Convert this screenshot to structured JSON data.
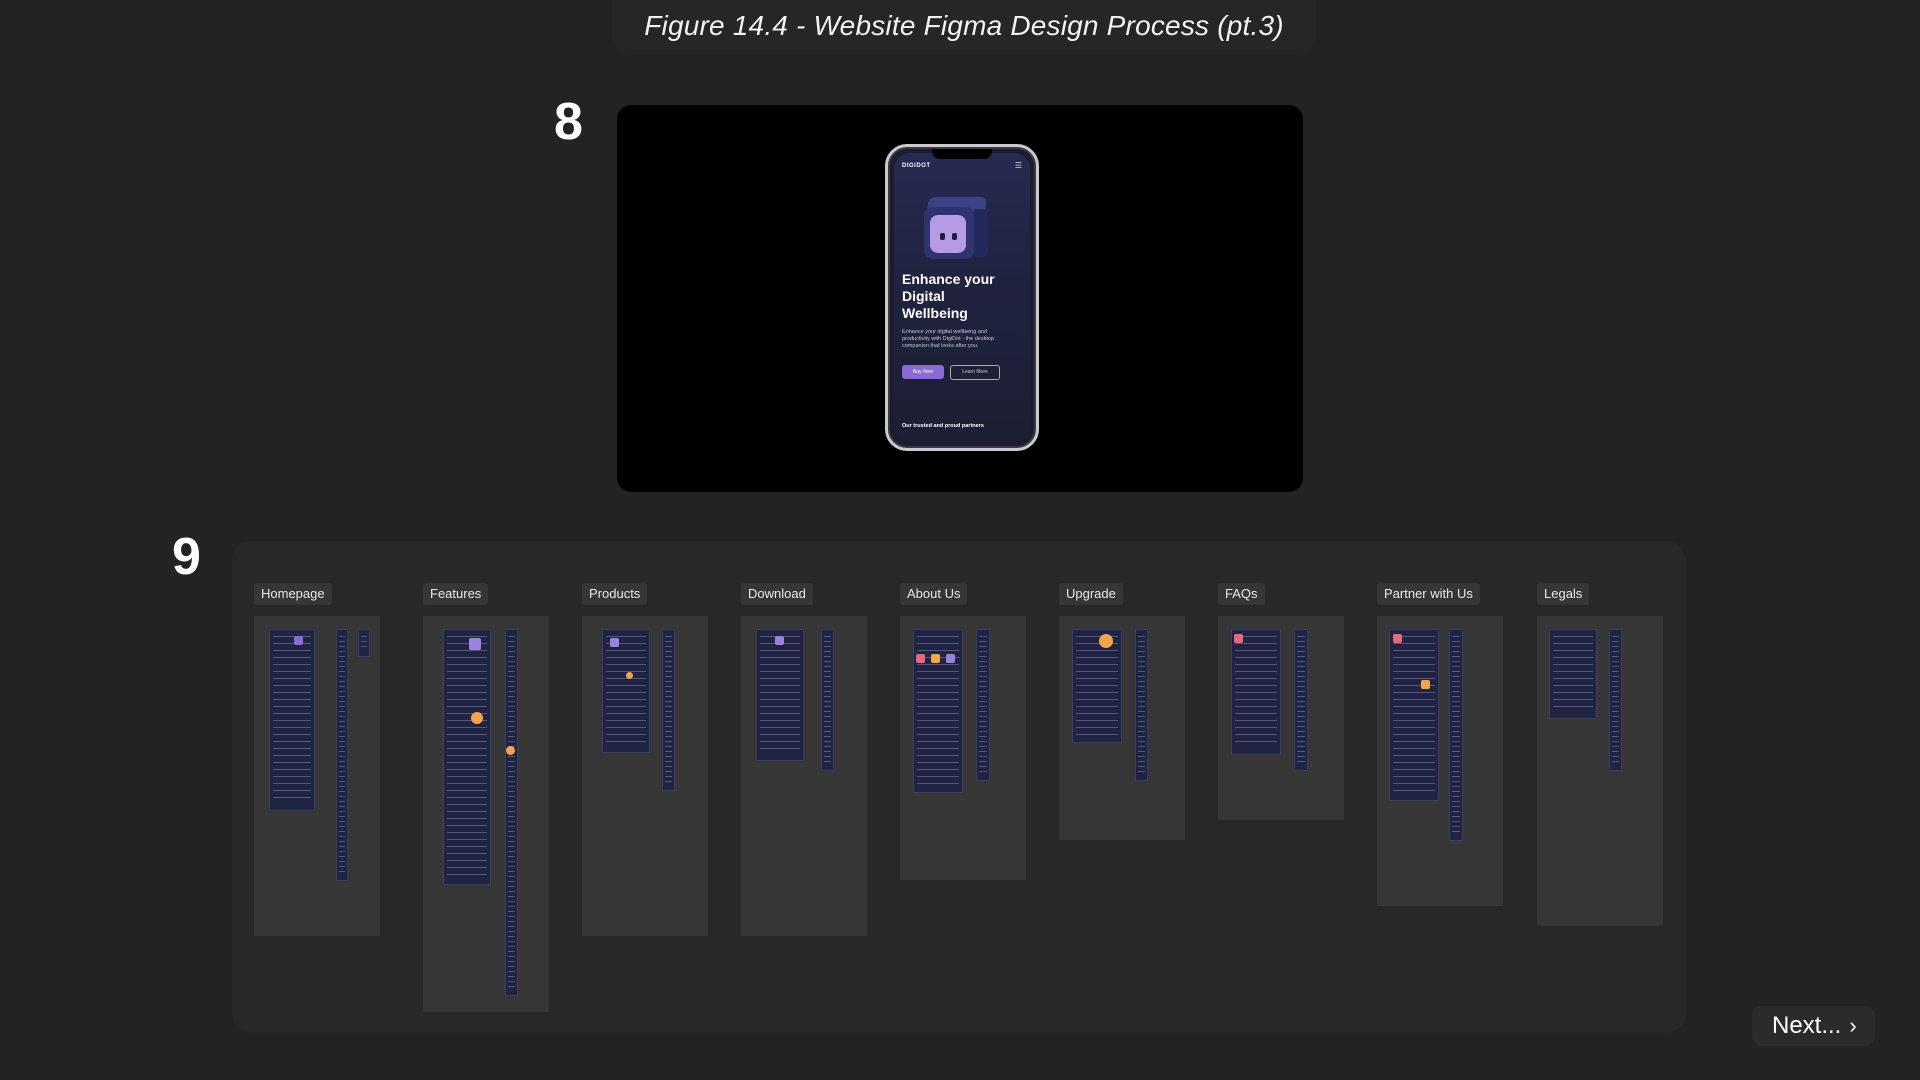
{
  "caption": "Figure 14.4 - Website Figma Design Process (pt.3)",
  "steps": [
    "8",
    "9"
  ],
  "phone_mockup": {
    "brand": "DIGIDOT",
    "menu_icon": "hamburger-icon",
    "hero_title": "Enhance your Digital Wellbeing",
    "hero_subtitle": "Enhance your digital wellbeing and productivity with DigiDot - the desktop companion that looks after you.",
    "buy_button": "Buy Now",
    "learn_button": "Learn More",
    "partners_text": "Our trusted and proud partners"
  },
  "frames": [
    "Homepage",
    "Features",
    "Products",
    "Download",
    "About Us",
    "Upgrade",
    "FAQs",
    "Partner with Us",
    "Legals"
  ],
  "next_label": "Next...",
  "next_icon": "chevron-right-icon",
  "colors": {
    "background": "#232323",
    "board": "#282828",
    "frame": "#363636",
    "page_thumb": "#202442",
    "accent_purple": "#8b6bd3"
  }
}
